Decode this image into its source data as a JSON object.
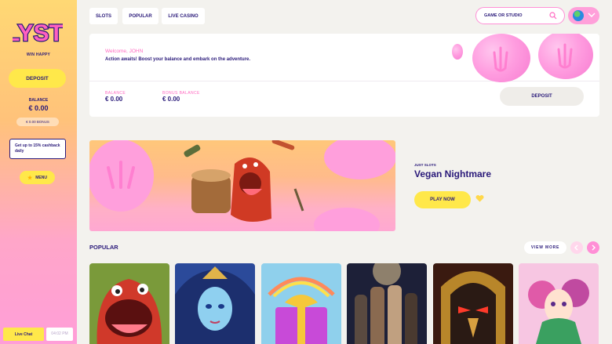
{
  "sidebar": {
    "logo_text": "LYSTI",
    "tagline": "WIN HAPPY",
    "deposit_label": "DEPOSIT",
    "balance_label": "BALANCE",
    "balance_value": "€ 0.00",
    "bonus_value": "€ 0.00 BONUS",
    "cashback_text": "Get up to 15% cashback daily",
    "menu_label": "MENU",
    "live_chat_label": "Live Chat",
    "clock": "04:02 PM"
  },
  "nav": {
    "tabs": [
      {
        "label": "SLOTS"
      },
      {
        "label": "POPULAR"
      },
      {
        "label": "LIVE CASINO"
      }
    ],
    "search_placeholder": "GAME OR STUDIO"
  },
  "welcome": {
    "title": "Welcome, JOHN",
    "message": "Action awaits! Boost your balance and embark on the adventure.",
    "balance_label": "BALANCE",
    "balance_value": "€ 0.00",
    "bonus_label": "BONUS BALANCE",
    "bonus_value": "€ 0.00",
    "deposit_label": "DEPOSIT"
  },
  "hero": {
    "kicker": "JUST SLOTS",
    "title": "Vegan Nightmare",
    "play_label": "PLAY NOW"
  },
  "popular": {
    "title": "POPULAR",
    "view_more": "VIEW MORE"
  },
  "colors": {
    "brand_navy": "#2a1a7a",
    "accent_yellow": "#ffe84a",
    "accent_pink": "#ff8fd6"
  },
  "icons": [
    "search-icon",
    "globe-icon",
    "chevron-down-icon",
    "star-icon",
    "heart-icon",
    "arrow-left-icon",
    "arrow-right-icon"
  ]
}
